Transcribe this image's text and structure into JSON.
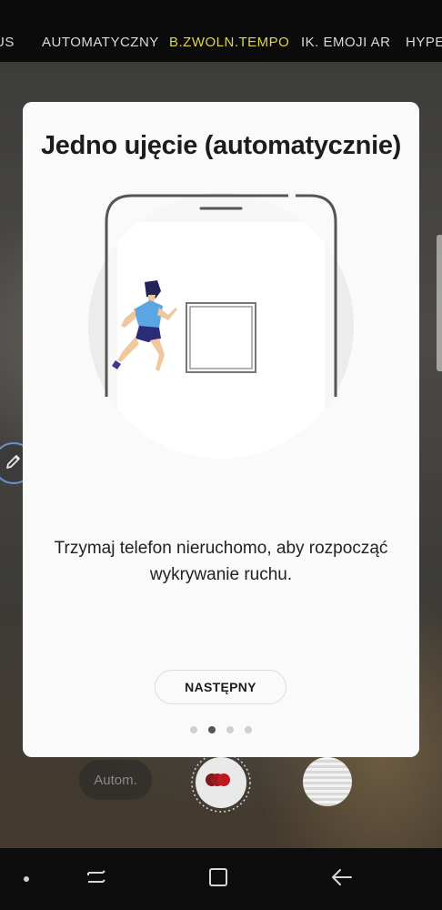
{
  "mode_strip": {
    "modes": [
      "US",
      "AUTOMATYCZNY",
      "B.ZWOLN.TEMPO",
      "IK. EMOJI AR",
      "HYPE"
    ],
    "active_index": 2,
    "active_color": "#e1d34a"
  },
  "dialog": {
    "title": "Jedno ujęcie (automatycznie)",
    "description": "Trzymaj telefon nieruchomo, aby rozpocząć wykrywanie ruchu.",
    "next_label": "NASTĘPNY",
    "page_count": 4,
    "current_page": 2
  },
  "camera_controls": {
    "auto_label": "Autom.",
    "shutter_accent": "#c0181e"
  },
  "navbar": {
    "icons": [
      "dot-icon",
      "recents-icon",
      "home-icon",
      "back-icon"
    ]
  }
}
